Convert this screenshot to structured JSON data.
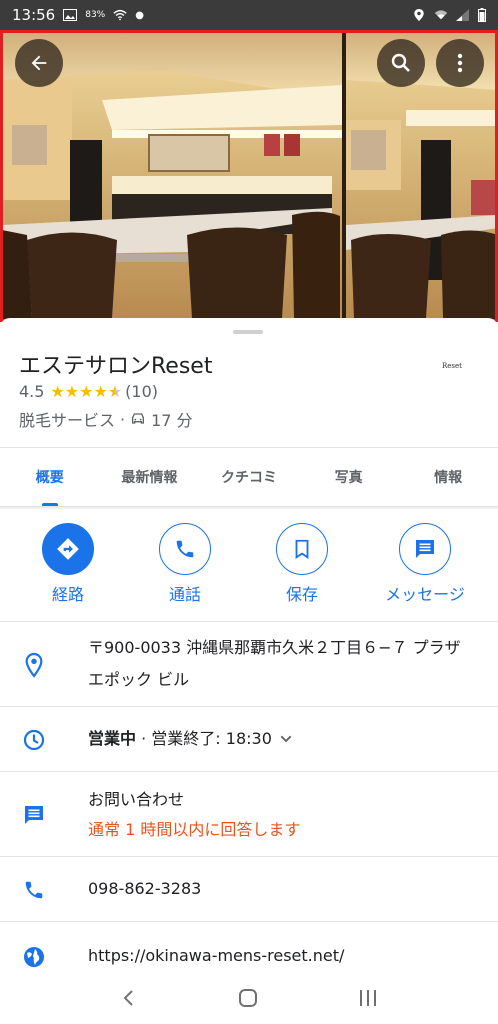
{
  "status_bar": {
    "time": "13:56",
    "battery_small": "83%",
    "icons": [
      "image-icon",
      "battery-saver-icon",
      "wifi-icon",
      "dot-icon",
      "location-icon",
      "wifi-signal-icon",
      "cell-signal-icon",
      "battery-icon"
    ]
  },
  "header": {
    "back_icon": "arrow-left-icon",
    "search_icon": "search-icon",
    "more_icon": "more-vert-icon"
  },
  "place": {
    "title": "エステサロンReset",
    "logo_text": "Reset",
    "rating": "4.5",
    "review_count": "(10)",
    "stars": 4.5,
    "category": "脱毛サービス",
    "separator": "·",
    "drive_time": "17 分"
  },
  "tabs": [
    {
      "label": "概要",
      "active": true
    },
    {
      "label": "最新情報",
      "active": false
    },
    {
      "label": "クチコミ",
      "active": false
    },
    {
      "label": "写真",
      "active": false
    },
    {
      "label": "情報",
      "active": false
    }
  ],
  "actions": [
    {
      "label": "経路",
      "icon": "directions-icon"
    },
    {
      "label": "通話",
      "icon": "phone-icon"
    },
    {
      "label": "保存",
      "icon": "bookmark-icon"
    },
    {
      "label": "メッセージ",
      "icon": "message-icon"
    }
  ],
  "info": {
    "address": "〒900-0033 沖縄県那覇市久米２丁目６−７ プラザ エポック ビル",
    "hours_status": "営業中",
    "hours_sep": " · ",
    "hours_detail": "営業終了: 18:30",
    "inquiry_title": "お問い合わせ",
    "inquiry_sub": "通常 1 時間以内に回答します",
    "phone": "098-862-3283",
    "website": "https://okinawa-mens-reset.net/"
  },
  "colors": {
    "accent": "#1a73e8",
    "star": "#fbbc04",
    "highlight_outline": "#e02020",
    "inquiry_sub": "#e8541c"
  }
}
